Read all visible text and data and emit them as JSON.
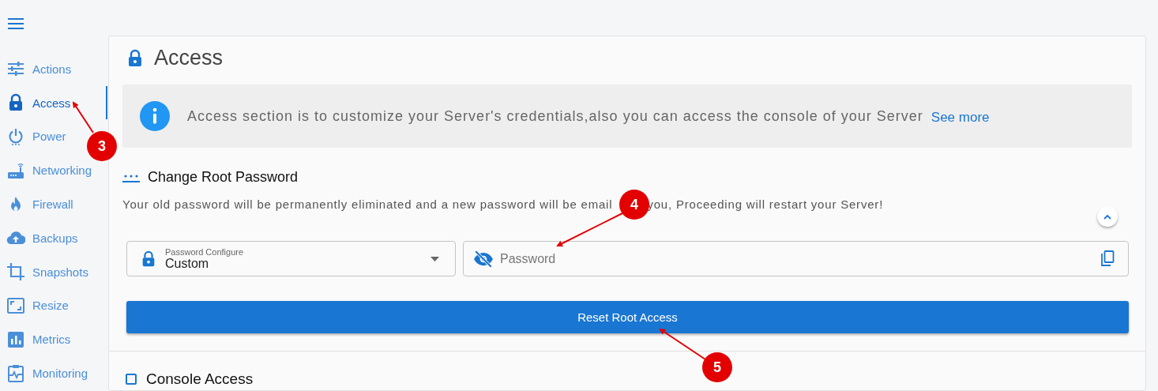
{
  "sidebar": {
    "items": [
      {
        "label": "Actions",
        "selected": false
      },
      {
        "label": "Access",
        "selected": true
      },
      {
        "label": "Power",
        "selected": false
      },
      {
        "label": "Networking",
        "selected": false
      },
      {
        "label": "Firewall",
        "selected": false
      },
      {
        "label": "Backups",
        "selected": false
      },
      {
        "label": "Snapshots",
        "selected": false
      },
      {
        "label": "Resize",
        "selected": false
      },
      {
        "label": "Metrics",
        "selected": false
      },
      {
        "label": "Monitoring",
        "selected": false
      }
    ]
  },
  "page": {
    "title": "Access",
    "info": {
      "text": "Access section is to customize your Server's credentials,also you can access the console of your Server",
      "link": "See more"
    },
    "root_password": {
      "heading": "Change Root Password",
      "description": [
        "Your old password will be permanently eliminated and a new password will be email",
        "you, Proceeding will restart your Server!"
      ],
      "expanded": true,
      "config_select": {
        "label": "Password Configure",
        "value": "Custom"
      },
      "password_field": {
        "placeholder": "Password"
      },
      "button": "Reset Root Access"
    },
    "console": {
      "heading": "Console Access"
    }
  },
  "annotations": [
    {
      "label": "3"
    },
    {
      "label": "4"
    },
    {
      "label": "5"
    }
  ]
}
